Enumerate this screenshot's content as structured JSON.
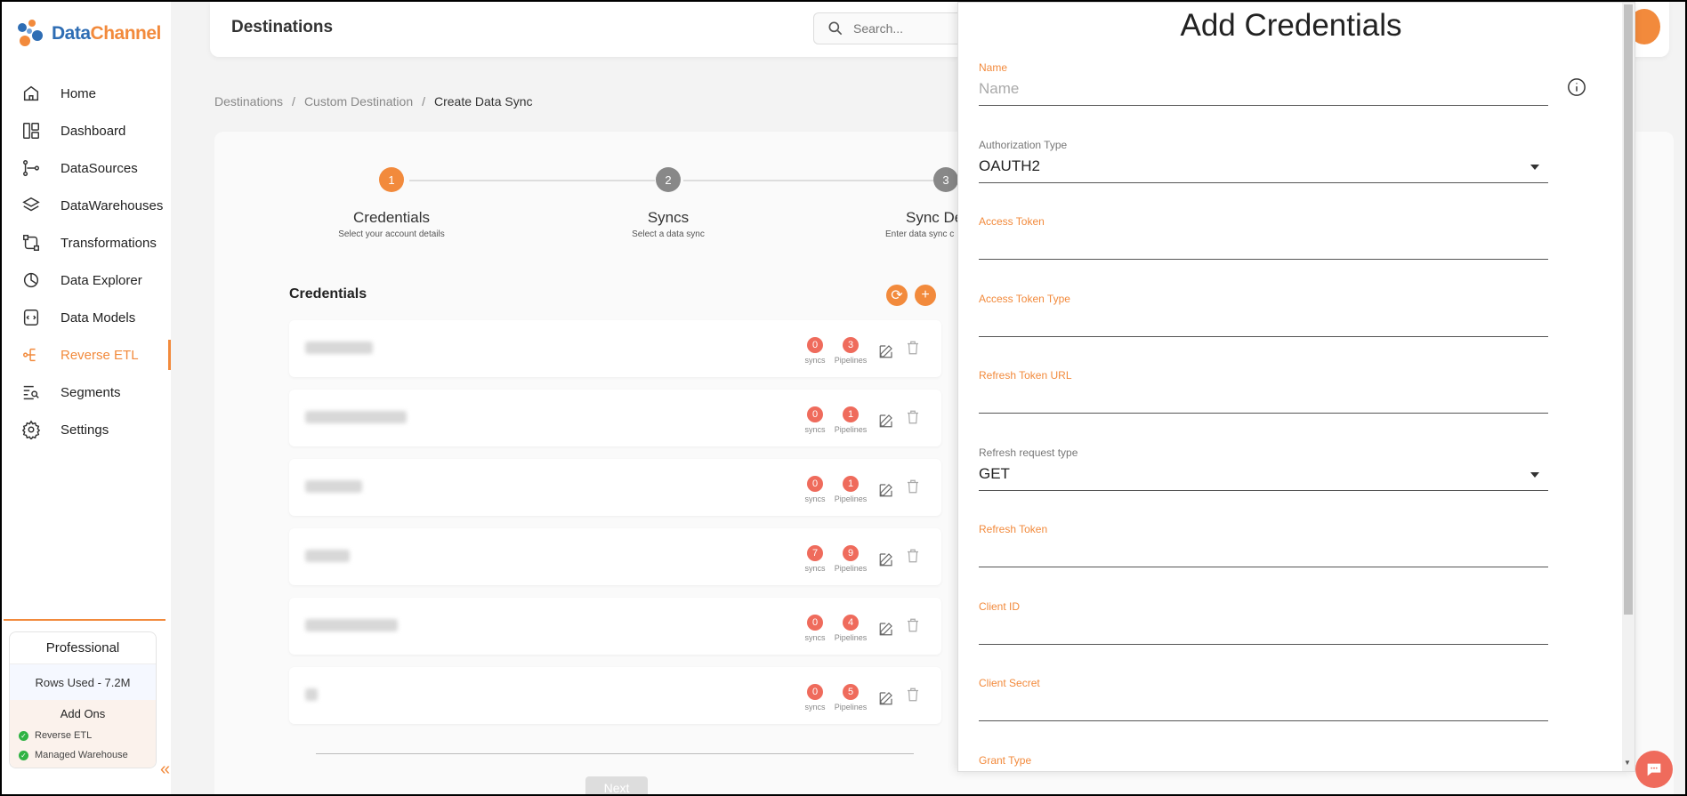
{
  "sidebar": {
    "logo": {
      "part1": "Data",
      "part2": "Channel"
    },
    "items": [
      {
        "label": "Home",
        "icon": "home-icon"
      },
      {
        "label": "Dashboard",
        "icon": "dashboard-icon"
      },
      {
        "label": "DataSources",
        "icon": "datasources-icon"
      },
      {
        "label": "DataWarehouses",
        "icon": "layers-icon"
      },
      {
        "label": "Transformations",
        "icon": "transform-icon"
      },
      {
        "label": "Data Explorer",
        "icon": "explorer-icon"
      },
      {
        "label": "Data Models",
        "icon": "models-icon"
      },
      {
        "label": "Reverse ETL",
        "icon": "reverse-etl-icon",
        "active": true
      },
      {
        "label": "Segments",
        "icon": "segments-icon"
      },
      {
        "label": "Settings",
        "icon": "gear-icon"
      }
    ],
    "plan": {
      "name": "Professional",
      "rows_used": "Rows Used - 7.2M",
      "addons_title": "Add Ons",
      "addons": [
        "Reverse ETL",
        "Managed Warehouse"
      ]
    },
    "accent": "#f28a3c"
  },
  "header": {
    "title": "Destinations",
    "search_placeholder": "Search..."
  },
  "breadcrumb": [
    "Destinations",
    "/",
    "Custom Destination",
    "/",
    "Create Data Sync"
  ],
  "stepper": [
    {
      "num": "1",
      "title": "Credentials",
      "subtitle": "Select your account details",
      "state": "active"
    },
    {
      "num": "2",
      "title": "Syncs",
      "subtitle": "Select a data sync",
      "state": "pending"
    },
    {
      "num": "3",
      "title": "Sync De",
      "subtitle": "Enter data sync c",
      "state": "pending"
    }
  ],
  "credentials": {
    "heading": "Credentials",
    "syncs_label": "syncs",
    "pipelines_label": "Pipelines",
    "rows": [
      {
        "syncs": "0",
        "pipelines": "3"
      },
      {
        "syncs": "0",
        "pipelines": "1"
      },
      {
        "syncs": "0",
        "pipelines": "1"
      },
      {
        "syncs": "7",
        "pipelines": "9"
      },
      {
        "syncs": "0",
        "pipelines": "4"
      },
      {
        "syncs": "0",
        "pipelines": "5"
      }
    ],
    "next_label": "Next"
  },
  "drawer": {
    "title": "Add Credentials",
    "fields": [
      {
        "label": "Name",
        "placeholder": "Name",
        "value": "",
        "type": "text",
        "label_style": "accent"
      },
      {
        "label": "Authorization Type",
        "value": "OAUTH2",
        "type": "select",
        "label_style": "grey"
      },
      {
        "label": "Access Token",
        "value": "",
        "type": "text",
        "label_style": "accent"
      },
      {
        "label": "Access Token Type",
        "value": "",
        "type": "text",
        "label_style": "accent"
      },
      {
        "label": "Refresh Token URL",
        "value": "",
        "type": "text",
        "label_style": "accent"
      },
      {
        "label": "Refresh request type",
        "value": "GET",
        "type": "select",
        "label_style": "grey"
      },
      {
        "label": "Refresh Token",
        "value": "",
        "type": "text",
        "label_style": "accent"
      },
      {
        "label": "Client ID",
        "value": "",
        "type": "text",
        "label_style": "accent"
      },
      {
        "label": "Client Secret",
        "value": "",
        "type": "text",
        "label_style": "accent"
      },
      {
        "label": "Grant Type",
        "value": "",
        "type": "text",
        "label_style": "accent"
      }
    ]
  }
}
